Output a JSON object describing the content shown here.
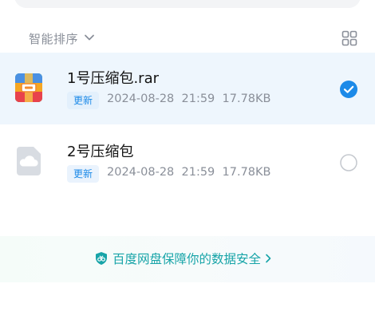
{
  "sort": {
    "label": "智能排序"
  },
  "files": [
    {
      "name": "1号压缩包.rar",
      "badge": "更新",
      "date": "2024-08-28",
      "time": "21:59",
      "size": "17.78KB",
      "icon": "rar-archive-icon",
      "selected": true
    },
    {
      "name": "2号压缩包",
      "badge": "更新",
      "date": "2024-08-28",
      "time": "21:59",
      "size": "17.78KB",
      "icon": "cloud-file-icon",
      "selected": false
    }
  ],
  "banner": {
    "text": "百度网盘保障你的数据安全",
    "icon": "shield-icon"
  },
  "colors": {
    "accent": "#1c8ae8",
    "selected_row": "#eef6fd",
    "security": "#17a4a8"
  }
}
